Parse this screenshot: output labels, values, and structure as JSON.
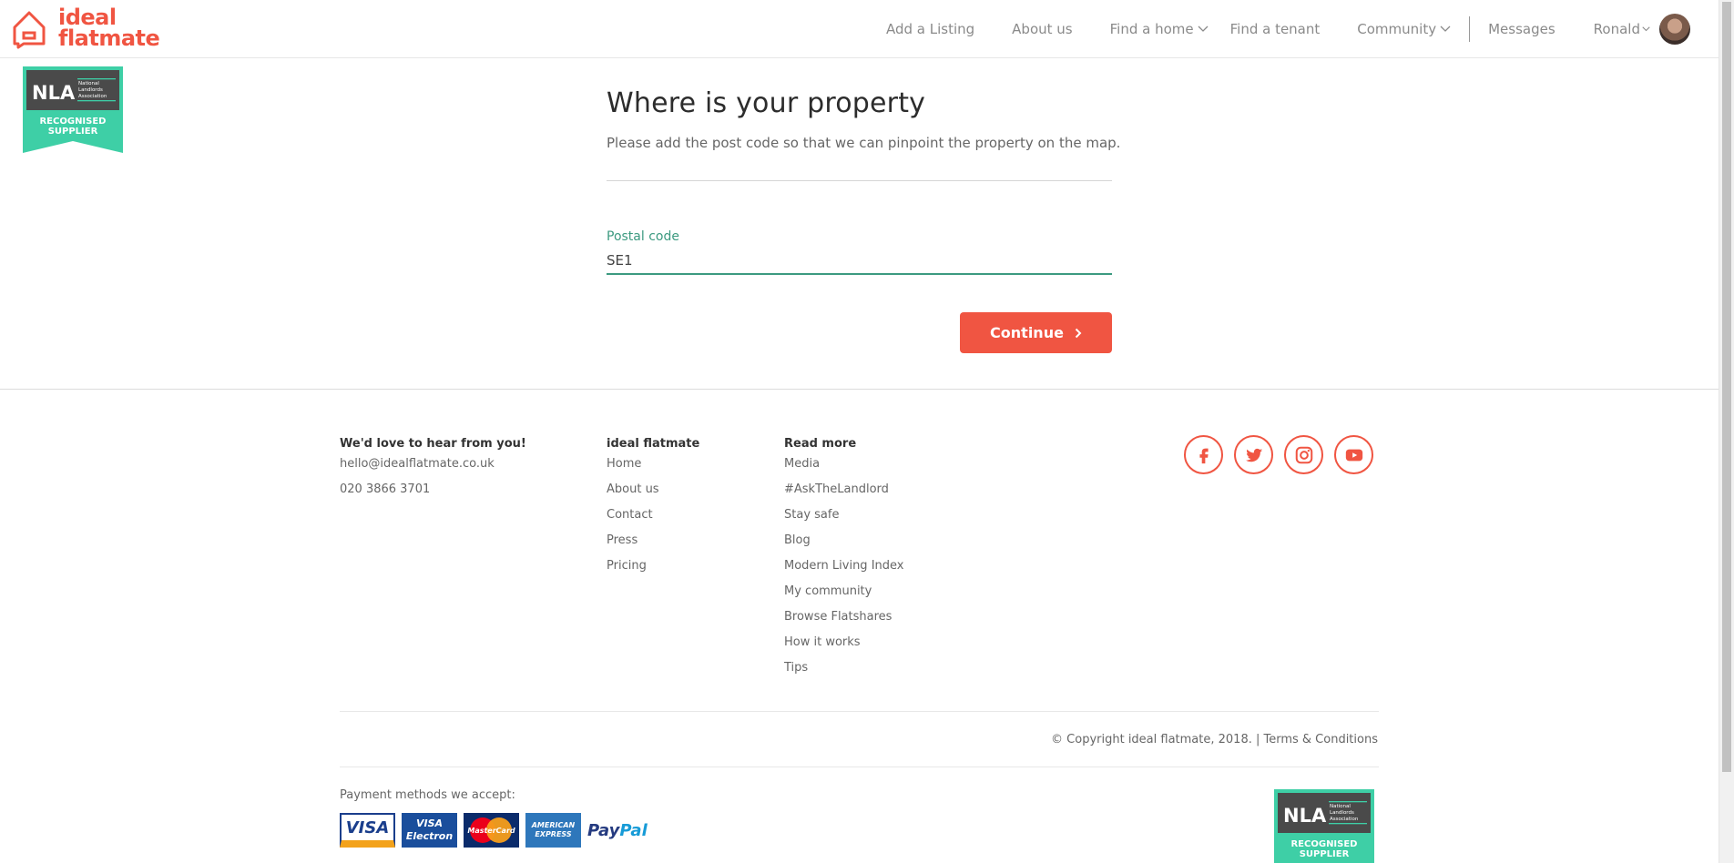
{
  "header": {
    "logo_line1": "ideal",
    "logo_line2": "flatmate",
    "nav": {
      "add_listing": "Add a Listing",
      "about": "About us",
      "find_home": "Find a home",
      "find_tenant": "Find a tenant",
      "community": "Community",
      "messages": "Messages",
      "user": "Ronald"
    }
  },
  "badge": {
    "nla": "NLA",
    "assoc": [
      "National",
      "Landlords",
      "Association"
    ],
    "line1": "RECOGNISED",
    "line2": "SUPPLIER"
  },
  "form": {
    "title": "Where is your property",
    "subtitle": "Please add the post code so that we can pinpoint the property on the map.",
    "postal_label": "Postal code",
    "postal_value": "SE1",
    "continue_label": "Continue"
  },
  "footer": {
    "contact": {
      "heading": "We'd love to hear from you!",
      "email": "hello@idealflatmate.co.uk",
      "phone": "020 3866 3701"
    },
    "company": {
      "heading": "ideal flatmate",
      "links": [
        "Home",
        "About us",
        "Contact",
        "Press",
        "Pricing"
      ]
    },
    "read_more": {
      "heading": "Read more",
      "links": [
        "Media",
        "#AskTheLandlord",
        "Stay safe",
        "Blog",
        "Modern Living Index",
        "My community",
        "Browse Flatshares",
        "How it works",
        "Tips"
      ]
    },
    "social": [
      "facebook-icon",
      "twitter-icon",
      "instagram-icon",
      "youtube-icon"
    ],
    "copyright": "© Copyright ideal flatmate, 2018. | Terms & Conditions",
    "payment_label": "Payment methods we accept:",
    "cards": {
      "visa": "VISA",
      "electron_1": "VISA",
      "electron_2": "Electron",
      "mastercard": "MasterCard",
      "amex_1": "AMERICAN",
      "amex_2": "EXPRESS",
      "paypal_1": "Pay",
      "paypal_2": "Pal"
    }
  },
  "colors": {
    "brand": "#f05542",
    "accent": "#3c9a80",
    "nla_teal": "#3ecfa6",
    "nla_dark": "#4a4a4a"
  }
}
